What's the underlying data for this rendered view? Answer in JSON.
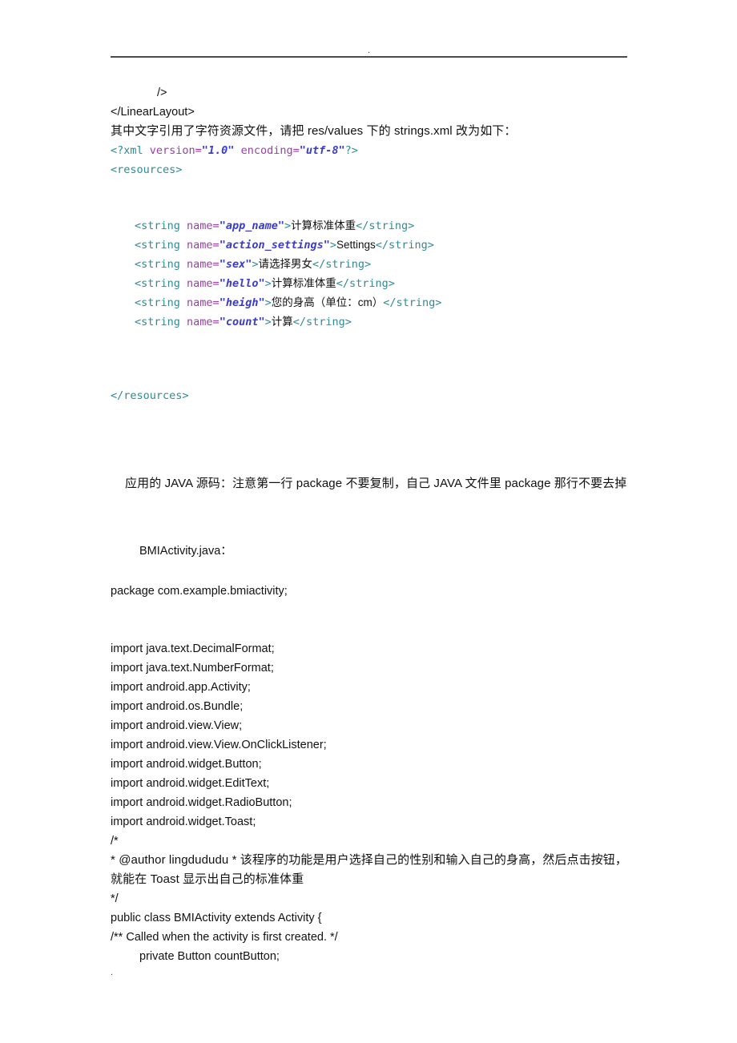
{
  "header": {
    "dot": ".",
    "rule": true
  },
  "footer": {
    "dot": "."
  },
  "document": {
    "xml_layout_tail": {
      "self_close": "/>",
      "close_linearlayout": "</LinearLayout>"
    },
    "note_strings_xml": "其中文字引用了字符资源文件，请把 res/values 下的 strings.xml 改为如下：",
    "xml_decl": {
      "tag_open": "<?xml",
      "attr1_name": " version=",
      "attr1_value": "\"1.0\"",
      "attr2_name": " encoding=",
      "attr2_value": "\"utf-8\"",
      "tag_close": "?>"
    },
    "resources_open": "<resources>",
    "resources_close": "</resources>",
    "strings": [
      {
        "open": "<string",
        "attr": " name=",
        "value": "\"app_name\"",
        "gt": ">",
        "text": "计算标准体重",
        "close": "</string>"
      },
      {
        "open": "<string",
        "attr": " name=",
        "value": "\"action_settings\"",
        "gt": ">",
        "text": "Settings",
        "close": "</string>"
      },
      {
        "open": "<string",
        "attr": " name=",
        "value": "\"sex\"",
        "gt": ">",
        "text": "请选择男女",
        "close": "</string>"
      },
      {
        "open": "<string",
        "attr": " name=",
        "value": "\"hello\"",
        "gt": ">",
        "text": "计算标准体重",
        "close": "</string>"
      },
      {
        "open": "<string",
        "attr": " name=",
        "value": "\"heigh\"",
        "gt": ">",
        "text": "您的身高（单位：cm）",
        "close": "</string>"
      },
      {
        "open": "<string",
        "attr": " name=",
        "value": "\"count\"",
        "gt": ">",
        "text": "计算",
        "close": "</string>"
      }
    ],
    "java_intro": "应用的 JAVA 源码：注意第一行 package 不要复制，自己 JAVA 文件里 package 那行不要去掉",
    "java_file_title": "BMIActivity.java：",
    "package_line": "package com.example.bmiactivity;",
    "imports": [
      "import java.text.DecimalFormat;",
      "import java.text.NumberFormat;",
      "import android.app.Activity;",
      "import android.os.Bundle;",
      "import android.view.View;",
      "import android.view.View.OnClickListener;",
      "import android.widget.Button;",
      "import android.widget.EditText;",
      "import android.widget.RadioButton;",
      "import android.widget.Toast;"
    ],
    "comment_block": {
      "line1": "/*",
      "line2": "* @author lingdududu *  该程序的功能是用户选择自己的性别和输入自己的身高，然后点击按钮，就能在 Toast 显示出自己的标准体重",
      "line3": "*/"
    },
    "class_decl": "public class BMIActivity extends Activity {",
    "class_comment": "/** Called when the activity is first created. */",
    "field_decl": "private Button countButton;"
  },
  "colors": {
    "tag": "#2e8b96",
    "attribute": "#9b3ca8",
    "value": "#3a3ad0",
    "text": "#111111",
    "rule": "#4b4b4b",
    "background": "#ffffff"
  }
}
